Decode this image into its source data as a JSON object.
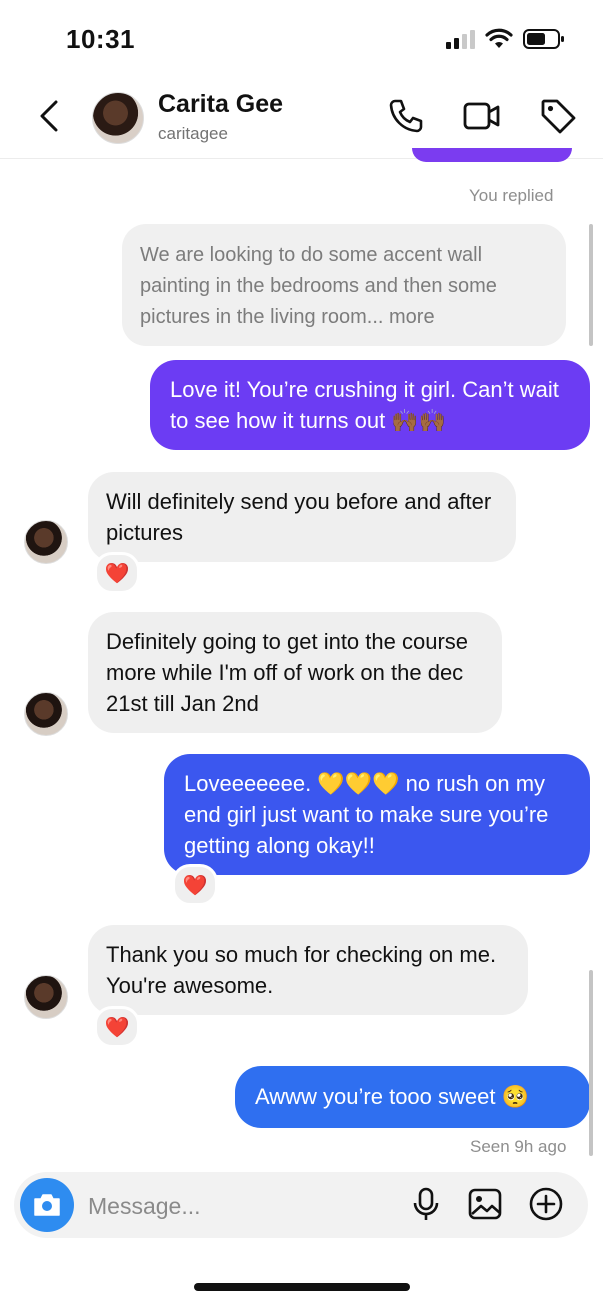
{
  "status_bar": {
    "time": "10:31"
  },
  "header": {
    "contact_name": "Carita Gee",
    "contact_handle": "caritagee",
    "icons": [
      "back-chevron-icon",
      "phone-icon",
      "video-icon",
      "tag-icon"
    ]
  },
  "thread": {
    "replied_label": "You replied",
    "reply_preview": "We are looking to do some accent wall painting in the bedrooms and then some pictures in the living room... more",
    "messages": [
      {
        "from": "me",
        "text": "Love it! You’re crushing it girl. Can’t wait to see how it turns out 🙌🏾🙌🏾"
      },
      {
        "from": "them",
        "text": "Will definitely send you before and after pictures",
        "reaction": "❤️"
      },
      {
        "from": "them",
        "text": "Definitely going to get into the course more while I'm off of work on the dec 21st till Jan 2nd"
      },
      {
        "from": "me",
        "text": "Loveeeeeee. 💛💛💛 no rush on my end girl just want to make sure you’re getting along okay!!",
        "reaction": "❤️"
      },
      {
        "from": "them",
        "text": "Thank you so much for checking on me. You're awesome.",
        "reaction": "❤️"
      },
      {
        "from": "me",
        "text": "Awww you’re tooo sweet 🥺"
      }
    ],
    "seen_label": "Seen 9h ago"
  },
  "composer": {
    "placeholder": "Message...",
    "icons": [
      "camera-icon",
      "microphone-icon",
      "gallery-icon",
      "plus-circle-icon"
    ]
  },
  "colors": {
    "purple_bubble": "#6c3cf3",
    "blue_bubble": "#3b57ef",
    "blue_bubble_light": "#2f6ff0",
    "camera_button": "#2e8cf0"
  }
}
